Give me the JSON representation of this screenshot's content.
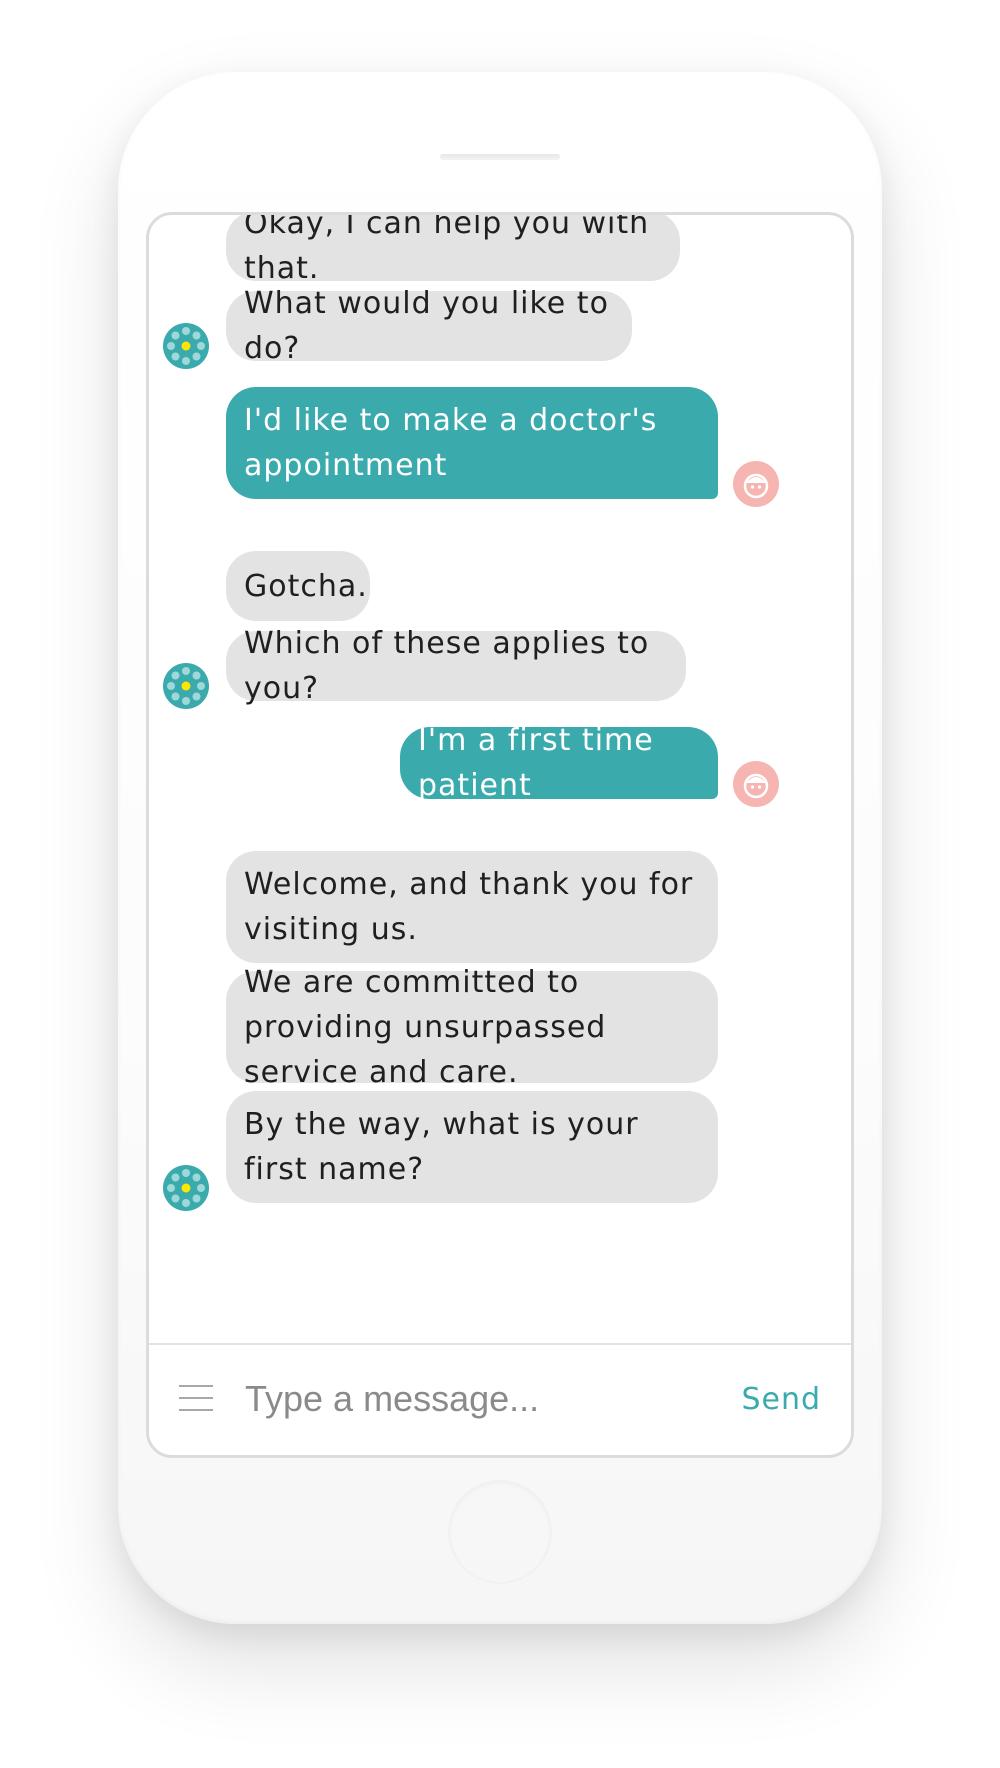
{
  "colors": {
    "accent": "#3aaaad",
    "bot_bubble": "#e3e3e3",
    "user_avatar": "#f7b5b1",
    "bot_avatar_center": "#ffe600"
  },
  "messages": [
    {
      "sender": "bot",
      "text": "Okay, I can help you with that."
    },
    {
      "sender": "bot",
      "text": "What would you like to do?"
    },
    {
      "sender": "user",
      "text": "I'd like to make a doctor's appointment"
    },
    {
      "sender": "bot",
      "text": "Gotcha."
    },
    {
      "sender": "bot",
      "text": "Which of these applies to you?"
    },
    {
      "sender": "user",
      "text": "I'm a first time patient"
    },
    {
      "sender": "bot",
      "text": "Welcome, and thank you for visiting us."
    },
    {
      "sender": "bot",
      "text": "We are committed to providing unsurpassed service and care."
    },
    {
      "sender": "bot",
      "text": "By the way, what is your first name?"
    }
  ],
  "icons": {
    "bot_avatar": "bot-avatar-icon",
    "user_avatar": "user-avatar-icon",
    "menu": "hamburger-menu-icon"
  },
  "composer": {
    "placeholder": "Type a message...",
    "send_label": "Send"
  }
}
